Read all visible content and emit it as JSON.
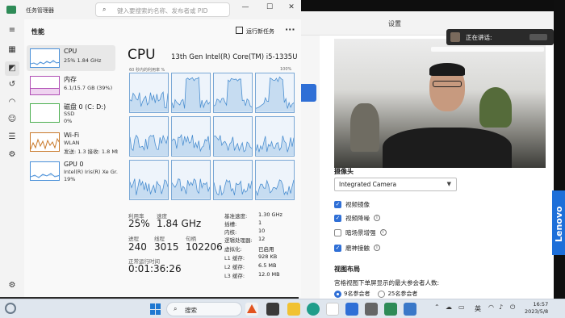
{
  "task_manager": {
    "app_name": "任务管理器",
    "search_placeholder": "键入要搜索的名称、发布者或 PID",
    "page_title": "性能",
    "run_new_task": "运行新任务",
    "more": "···",
    "window_buttons": {
      "minimize": "—",
      "maximize": "☐",
      "close": "✕"
    },
    "rail_icons": [
      "menu-icon",
      "processes-icon",
      "performance-icon",
      "app-history-icon",
      "startup-apps-icon",
      "users-icon",
      "details-icon",
      "services-icon",
      "settings-icon"
    ],
    "resources": [
      {
        "name": "CPU",
        "sub1": "25% 1.84 GHz",
        "sub2": "",
        "color": "#4a90d9"
      },
      {
        "name": "内存",
        "sub1": "6.1/15.7 GB (39%)",
        "sub2": "",
        "color": "#b04fb5"
      },
      {
        "name": "磁盘 0 (C: D:)",
        "sub1": "SSD",
        "sub2": "0%",
        "color": "#4caf50"
      },
      {
        "name": "Wi-Fi",
        "sub1": "WLAN",
        "sub2": "发送: 1.3 接收: 1.8 Mb",
        "color": "#c97a2b"
      },
      {
        "name": "GPU 0",
        "sub1": "Intel(R) Iris(R) Xe Gr...",
        "sub2": "19%",
        "color": "#4a90d9"
      }
    ],
    "cpu": {
      "title": "CPU",
      "model": "13th Gen Intel(R) Core(TM) i5-1335U",
      "graph_label": "60 秒内的利用率 %",
      "graph_max": "100%",
      "utilization_label": "利用率",
      "utilization": "25%",
      "speed_label": "速度",
      "speed": "1.84 GHz",
      "processes_label": "进程",
      "processes": "240",
      "threads_label": "线程",
      "threads": "3015",
      "handles_label": "句柄",
      "handles": "102206",
      "uptime_label": "正常运行时间",
      "uptime": "0:01:36:26",
      "specs": [
        {
          "k": "基准速度:",
          "v": "1.30 GHz"
        },
        {
          "k": "插槽:",
          "v": "1"
        },
        {
          "k": "内核:",
          "v": "10"
        },
        {
          "k": "逻辑处理器:",
          "v": "12"
        },
        {
          "k": "虚拟化:",
          "v": "已启用"
        },
        {
          "k": "L1 缓存:",
          "v": "928 KB"
        },
        {
          "k": "L2 缓存:",
          "v": "6.5 MB"
        },
        {
          "k": "L3 缓存:",
          "v": "12.0 MB"
        }
      ]
    }
  },
  "settings": {
    "title": "设置",
    "camera_section": "摄像头",
    "camera_value": "Integrated Camera",
    "options": [
      {
        "label": "视频镜像",
        "checked": true,
        "info": false
      },
      {
        "label": "视频降噪",
        "checked": true,
        "info": true
      },
      {
        "label": "暗场景增强",
        "checked": false,
        "info": true
      },
      {
        "label": "磨神接触",
        "checked": true,
        "info": true
      }
    ],
    "layout_section": "视图布局",
    "layout_desc": "宫格视图下单屏显示的最大参会者人数:",
    "layout_options": [
      "9名参会者",
      "25名参会者"
    ],
    "speaking_label": "正在讲话:"
  },
  "brand": "Lenovo",
  "taskbar": {
    "search": "搜索",
    "ime": "英",
    "time": "16:57",
    "date": "2023/5/8"
  }
}
